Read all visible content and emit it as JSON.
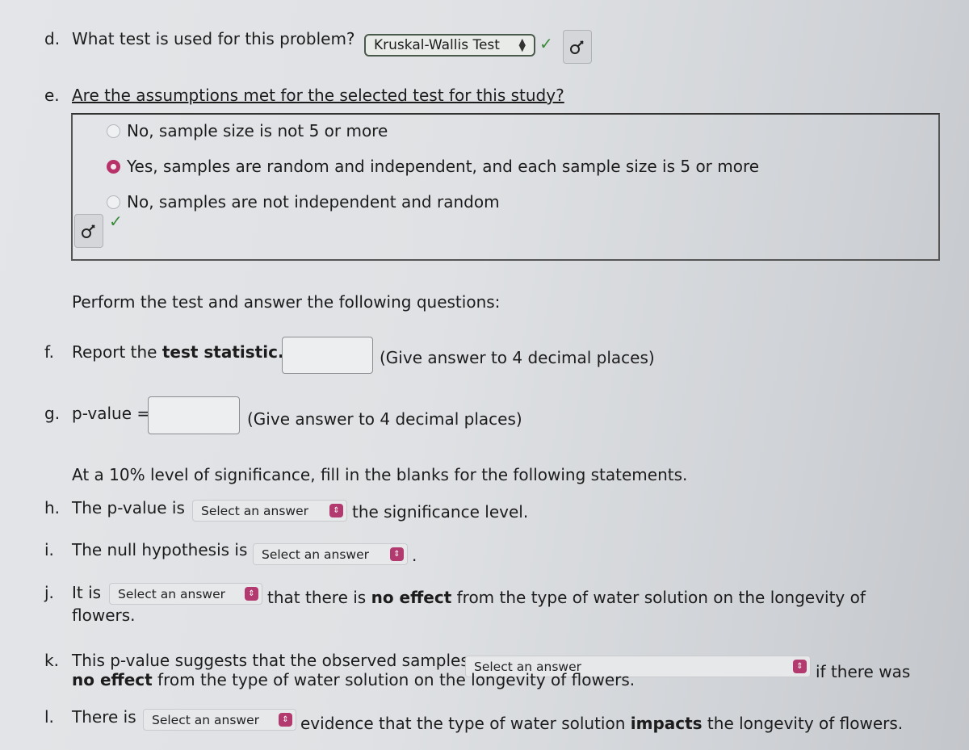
{
  "questions": {
    "d": {
      "letter": "d.",
      "text": "What test is used for this problem?",
      "select_value": "Kruskal-Wallis Test",
      "status": "correct"
    },
    "e": {
      "letter": "e.",
      "text": "Are the assumptions met for the selected test for this study?",
      "options": [
        {
          "label": "No, sample size is not 5 or more",
          "selected": false
        },
        {
          "label": "Yes, samples are random and independent, and each sample size is 5 or more",
          "selected": true
        },
        {
          "label": "No, samples are not independent and random",
          "selected": false
        }
      ],
      "status": "correct"
    },
    "intro": "Perform the test and answer the following questions:",
    "f": {
      "letter": "f.",
      "text_before": "Report the ",
      "text_bold": "test statistic.",
      "input_value": "",
      "hint": "(Give answer to 4 decimal places)"
    },
    "g": {
      "letter": "g.",
      "label": "p-value =",
      "input_value": "",
      "hint": "(Give answer to 4 decimal places)"
    },
    "significance_intro": "At a 10% level of significance, fill in the blanks for the following statements.",
    "h": {
      "letter": "h.",
      "before": "The p-value is",
      "select_value": "Select an answer",
      "after": "the significance level."
    },
    "i": {
      "letter": "i.",
      "before": "The null hypothesis is",
      "select_value": "Select an answer",
      "after": "."
    },
    "j": {
      "letter": "j.",
      "before": "It is",
      "select_value": "Select an answer",
      "after_1": "that there is ",
      "after_bold": "no effect",
      "after_2": " from the type of water solution on the longevity of",
      "line2": "flowers."
    },
    "k": {
      "letter": "k.",
      "before": "This p-value suggests that the observed samples",
      "select_value": "Select an answer",
      "after": "if there was",
      "line2_bold": "no effect",
      "line2_rest": " from the type of water solution on the longevity of flowers."
    },
    "l": {
      "letter": "l.",
      "before": "There is",
      "select_value": "Select an answer",
      "after_1": "evidence that the type of water solution ",
      "after_bold": "impacts",
      "after_2": " the longevity of flowers."
    }
  },
  "icons": {
    "check": "✓",
    "key": "⚷",
    "updown": "⇕"
  },
  "colors": {
    "accent": "#b33a6e",
    "correct": "#3a8a3a"
  }
}
